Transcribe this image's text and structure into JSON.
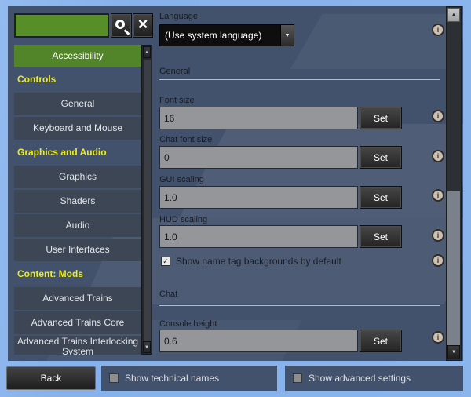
{
  "icons": {
    "close": "×",
    "dropdown_arrow": "▼",
    "scroll_up": "▲",
    "scroll_down": "▼",
    "check": "✓",
    "info": "i"
  },
  "search": {
    "value": ""
  },
  "sidebar": {
    "items": [
      {
        "label": "Accessibility",
        "type": "selected"
      },
      {
        "label": "Controls",
        "type": "header"
      },
      {
        "label": "General",
        "type": "item"
      },
      {
        "label": "Keyboard and Mouse",
        "type": "item"
      },
      {
        "label": "Graphics and Audio",
        "type": "header"
      },
      {
        "label": "Graphics",
        "type": "item"
      },
      {
        "label": "Shaders",
        "type": "item"
      },
      {
        "label": "Audio",
        "type": "item"
      },
      {
        "label": "User Interfaces",
        "type": "item"
      },
      {
        "label": "Content: Mods",
        "type": "header"
      },
      {
        "label": "Advanced Trains",
        "type": "item"
      },
      {
        "label": "Advanced Trains Core",
        "type": "item"
      },
      {
        "label": "Advanced Trains Interlocking System",
        "type": "item"
      }
    ]
  },
  "content": {
    "language_label": "Language",
    "language_value": "(Use system language)",
    "section_general": "General",
    "section_chat": "Chat",
    "rows": [
      {
        "label": "Font size",
        "value": "16",
        "button": "Set"
      },
      {
        "label": "Chat font size",
        "value": "0",
        "button": "Set"
      },
      {
        "label": "GUI scaling",
        "value": "1.0",
        "button": "Set"
      },
      {
        "label": "HUD scaling",
        "value": "1.0",
        "button": "Set"
      },
      {
        "label": "Console height",
        "value": "0.6",
        "button": "Set"
      }
    ],
    "nametag_checkbox": {
      "label": "Show name tag backgrounds by default",
      "checked": true
    }
  },
  "footer": {
    "back_label": "Back",
    "technical_names": {
      "label": "Show technical names",
      "checked": false
    },
    "advanced_settings": {
      "label": "Show advanced settings",
      "checked": false
    }
  },
  "colors": {
    "background": "#8ab4ec",
    "panel": "#42516c",
    "accent_green": "#52842a",
    "search_green": "#588e28",
    "header_yellow": "#ecec1e"
  }
}
